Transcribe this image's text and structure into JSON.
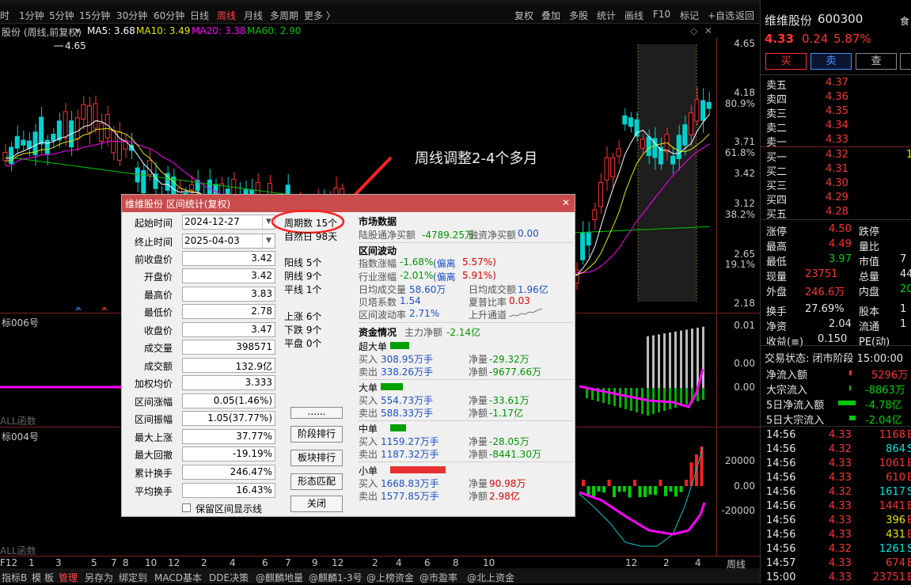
{
  "periods": {
    "items": [
      "时",
      "1分钟",
      "5分钟",
      "15分钟",
      "30分钟",
      "60分钟",
      "日线",
      "周线",
      "月线",
      "多周期",
      "更多 〉"
    ],
    "active_index": 7
  },
  "toolbar": {
    "items": [
      "复权",
      "叠加",
      "多股",
      "统计",
      "画线",
      "F10",
      "标记",
      "+自选",
      "返回"
    ]
  },
  "legend": {
    "stock": "股份 (周线,前复权)",
    "ma5": "MA5: 3.68",
    "ma10": "MA10: 3.49",
    "ma20": "MA20: 3.38",
    "ma60": "MA60: 2.90",
    "high_marker": "4.65",
    "colors": {
      "ma5": "#ffffff",
      "ma10": "#e6e600",
      "ma20": "#ff00ff",
      "ma60": "#00c800"
    }
  },
  "price_axis": [
    {
      "v": "4.65"
    },
    {
      "v": "4.18"
    },
    {
      "v": "80.9%"
    },
    {
      "v": "3.71"
    },
    {
      "v": "61.8%"
    },
    {
      "v": "3.42"
    },
    {
      "v": "3.12"
    },
    {
      "v": "38.2%"
    },
    {
      "v": "2.65"
    },
    {
      "v": "19.1%"
    },
    {
      "v": "2.18"
    }
  ],
  "annotation": "周线调整2-4个多月",
  "pane2": {
    "label": "标006号",
    "axis": [
      "0.01",
      "0.00",
      "0.00"
    ],
    "footer": "ALL函数"
  },
  "pane3": {
    "label": "标004号",
    "axis": [
      "20000",
      "0.00",
      "-20000"
    ],
    "footer": "ALL函数"
  },
  "date_axis": [
    "F12",
    "1",
    "3",
    "5",
    "7",
    "8",
    "10",
    "12",
    "2",
    "4",
    "6",
    "7",
    "9",
    "12",
    "2",
    "4",
    "6",
    "8",
    "10",
    "12",
    "2",
    "4",
    "周线"
  ],
  "statusbar": [
    "指标B",
    "模",
    "板",
    "管理",
    "另存为",
    "绑定到",
    "MACD基本",
    "DDE决策",
    "@麒麟地量",
    "@麒麟1-3号",
    "@上榜资金",
    "@市盈率",
    "@北上资金"
  ],
  "quote": {
    "name": "维维股份",
    "code": "600300",
    "price": "4.33",
    "change": "0.24",
    "pct": "5.87%",
    "side": "食",
    "buttons": [
      "买",
      "卖",
      "查"
    ],
    "asks": [
      {
        "l": "卖五",
        "p": "4.37"
      },
      {
        "l": "卖四",
        "p": "4.36"
      },
      {
        "l": "卖三",
        "p": "4.35"
      },
      {
        "l": "卖二",
        "p": "4.34"
      },
      {
        "l": "卖一",
        "p": "4.33"
      }
    ],
    "bids": [
      {
        "l": "买一",
        "p": "4.32"
      },
      {
        "l": "买二",
        "p": "4.31"
      },
      {
        "l": "买三",
        "p": "4.30"
      },
      {
        "l": "买四",
        "p": "4.29"
      },
      {
        "l": "买五",
        "p": "4.28"
      }
    ],
    "bid1_extra": "1",
    "stats": [
      {
        "l1": "涨停",
        "v1": "4.50",
        "l2": "跌停",
        "v2": ""
      },
      {
        "l1": "最高",
        "v1": "4.49",
        "l2": "量比",
        "v2": ""
      },
      {
        "l1": "最低",
        "v1": "3.97",
        "l2": "市值",
        "v2": "7"
      },
      {
        "l1": "现量",
        "v1": "23751",
        "l2": "总量",
        "v2": "44"
      },
      {
        "l1": "外盘",
        "v1": "246.6万",
        "l2": "内盘",
        "v2": "20"
      },
      {
        "l1": "换手",
        "v1": "27.69%",
        "l2": "股本",
        "v2": "1"
      },
      {
        "l1": "净资",
        "v1": "2.04",
        "l2": "流通",
        "v2": "1"
      },
      {
        "l1": "收益(≡)",
        "v1": "0.150",
        "l2": "PE(动)",
        "v2": ""
      }
    ],
    "trade_status": "交易状态: 闭市阶段 15:00:00",
    "flows": [
      {
        "l": "净流入额",
        "v": "5296万",
        "c": "red"
      },
      {
        "l": "大宗流入",
        "v": "-8863万",
        "c": "green"
      },
      {
        "l": "5日净流入额",
        "v": "-4.78亿",
        "c": "green"
      },
      {
        "l": "5日大宗流入",
        "v": "-2.04亿",
        "c": "green"
      }
    ],
    "ticks": [
      {
        "t": "14:56",
        "p": "4.33",
        "v": "1168",
        "s": "B"
      },
      {
        "t": "14:56",
        "p": "4.32",
        "v": "864",
        "s": "S"
      },
      {
        "t": "14:56",
        "p": "4.33",
        "v": "1061",
        "s": "B"
      },
      {
        "t": "14:56",
        "p": "4.33",
        "v": "610",
        "s": "B"
      },
      {
        "t": "14:56",
        "p": "4.32",
        "v": "1617",
        "s": "S"
      },
      {
        "t": "14:56",
        "p": "4.33",
        "v": "1441",
        "s": "B"
      },
      {
        "t": "14:56",
        "p": "4.33",
        "v": "396",
        "s": "B"
      },
      {
        "t": "14:56",
        "p": "4.33",
        "v": "431",
        "s": "B"
      },
      {
        "t": "14:56",
        "p": "4.32",
        "v": "1261",
        "s": "S"
      },
      {
        "t": "14:57",
        "p": "4.33",
        "v": "674",
        "s": "B"
      },
      {
        "t": "15:00",
        "p": "4.33",
        "v": "23751",
        "s": "B"
      }
    ]
  },
  "dialog": {
    "title": "维维股份 区间统计(复权)",
    "fields": [
      {
        "l": "起始时间",
        "v": "2024-12-27"
      },
      {
        "l": "终止时间",
        "v": "2025-04-03"
      },
      {
        "l": "前收盘价",
        "v": "3.42"
      },
      {
        "l": "开盘价",
        "v": "3.42"
      },
      {
        "l": "最高价",
        "v": "3.83"
      },
      {
        "l": "最低价",
        "v": "2.78"
      },
      {
        "l": "收盘价",
        "v": "3.47"
      },
      {
        "l": "成交量",
        "v": "398571"
      },
      {
        "l": "成交额",
        "v": "132.9亿"
      },
      {
        "l": "加权均价",
        "v": "3.333"
      },
      {
        "l": "区间涨幅",
        "v": "0.05(1.46%)"
      },
      {
        "l": "区间振幅",
        "v": "1.05(37.77%)"
      },
      {
        "l": "最大上涨",
        "v": "37.77%"
      },
      {
        "l": "最大回撤",
        "v": "-19.19%"
      },
      {
        "l": "累计换手",
        "v": "246.47%"
      },
      {
        "l": "平均换手",
        "v": "16.43%"
      }
    ],
    "keep_label": "保留区间显示线",
    "periods": "周期数 15个",
    "natural_days": "自然日 98天",
    "yang": "阳线 5个",
    "yin": "阴线 9个",
    "flat": "平线 1个",
    "up": "上涨 6个",
    "down": "下跌 9个",
    "flat2": "平盘 0个",
    "buttons": [
      "......",
      "阶段排行",
      "板块排行",
      "形态匹配",
      "关闭"
    ],
    "market": {
      "h": "市场数据",
      "a": "陆股通净买额",
      "av": "-4789.25万",
      "b": "融资净买额",
      "bv": "0.00"
    },
    "wave": {
      "h": "区间波动",
      "idx": "指数涨幅",
      "idxv": "-1.68%",
      "idxd": "(偏离",
      "idxdv": "5.57%)",
      "ind": "行业涨幅",
      "indv": "-2.01%",
      "indd": "(偏离",
      "inddv": "5.91%)",
      "vol": "日均成交量",
      "volv": "58.60万",
      "amt": "日均成交额",
      "amtv": "1.96亿",
      "beta": "贝塔系数",
      "betav": "1.54",
      "sharpe": "夏普比率",
      "sharpev": "0.03",
      "vola": "区间波动率",
      "volav": "2.71%",
      "trend": "上升通道"
    },
    "funds": {
      "h": "资金情况",
      "main": "主力净额",
      "mainv": "-2.14亿",
      "groups": [
        {
          "name": "超大单",
          "buy": "买入",
          "buyv": "308.95万手",
          "net": "净量",
          "netv": "-29.32万",
          "sell": "卖出",
          "sellv": "338.26万手",
          "amt": "净额",
          "amtv": "-9677.66万"
        },
        {
          "name": "大单",
          "buy": "买入",
          "buyv": "554.73万手",
          "net": "净量",
          "netv": "-33.61万",
          "sell": "卖出",
          "sellv": "588.33万手",
          "amt": "净额",
          "amtv": "-1.17亿"
        },
        {
          "name": "中单",
          "buy": "买入",
          "buyv": "1159.27万手",
          "net": "净量",
          "netv": "-28.05万",
          "sell": "卖出",
          "sellv": "1187.32万手",
          "amt": "净额",
          "amtv": "-8441.30万"
        },
        {
          "name": "小单",
          "buy": "买入",
          "buyv": "1668.83万手",
          "net": "净量",
          "netv": "90.98万",
          "sell": "卖出",
          "sellv": "1577.85万手",
          "amt": "净额",
          "amtv": "2.98亿"
        }
      ]
    }
  }
}
